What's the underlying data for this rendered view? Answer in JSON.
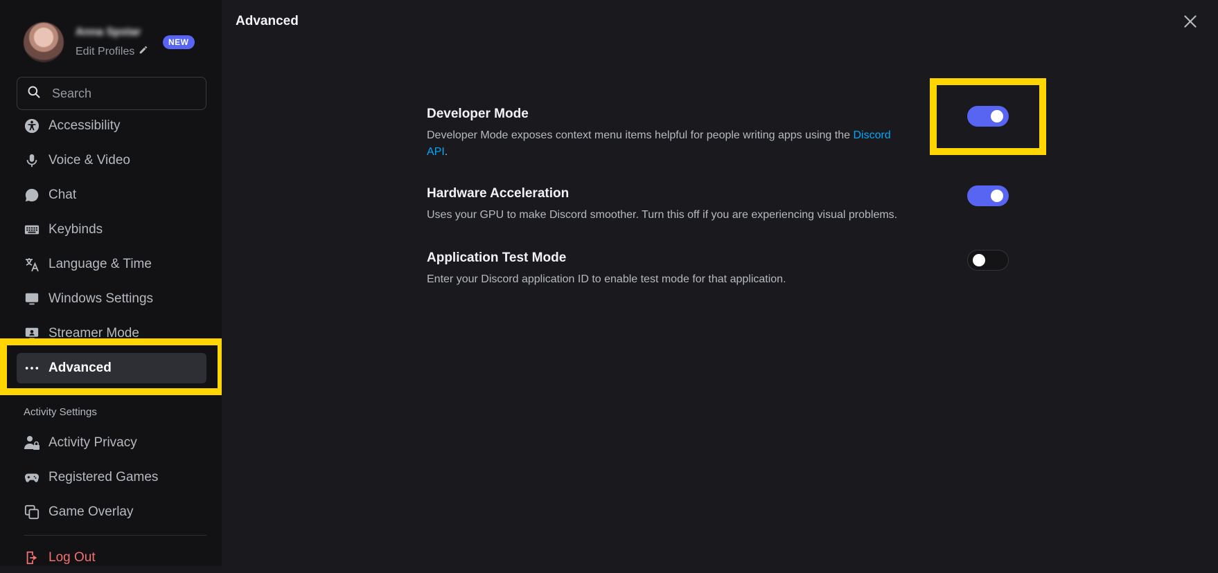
{
  "sidebar": {
    "profile": {
      "username": "Anna Spstar",
      "edit_label": "Edit Profiles",
      "badge": "NEW"
    },
    "search": {
      "placeholder": "Search"
    },
    "items": [
      {
        "label": "Accessibility",
        "icon": "accessibility-icon"
      },
      {
        "label": "Voice & Video",
        "icon": "microphone-icon"
      },
      {
        "label": "Chat",
        "icon": "chat-bubble-icon"
      },
      {
        "label": "Keybinds",
        "icon": "keyboard-icon"
      },
      {
        "label": "Language & Time",
        "icon": "translate-icon"
      },
      {
        "label": "Windows Settings",
        "icon": "monitor-icon"
      },
      {
        "label": "Streamer Mode",
        "icon": "streamer-icon"
      },
      {
        "label": "Advanced",
        "icon": "ellipsis-icon",
        "active": true
      }
    ],
    "activity_section_label": "Activity Settings",
    "activity_items": [
      {
        "label": "Activity Privacy",
        "icon": "activity-privacy-icon"
      },
      {
        "label": "Registered Games",
        "icon": "gamepad-icon"
      },
      {
        "label": "Game Overlay",
        "icon": "overlay-icon"
      }
    ],
    "logout_label": "Log Out"
  },
  "main": {
    "title": "Advanced",
    "settings": [
      {
        "title": "Developer Mode",
        "desc_prefix": "Developer Mode exposes context menu items helpful for people writing apps using the ",
        "desc_link": "Discord API",
        "desc_suffix": ".",
        "enabled": true
      },
      {
        "title": "Hardware Acceleration",
        "desc": "Uses your GPU to make Discord smoother. Turn this off if you are experiencing visual problems.",
        "enabled": true
      },
      {
        "title": "Application Test Mode",
        "desc": "Enter your Discord application ID to enable test mode for that application.",
        "enabled": false
      }
    ]
  },
  "colors": {
    "accent": "#5865f2",
    "highlight": "#ffd600",
    "link": "#00a8fc",
    "danger": "#f2706f"
  }
}
